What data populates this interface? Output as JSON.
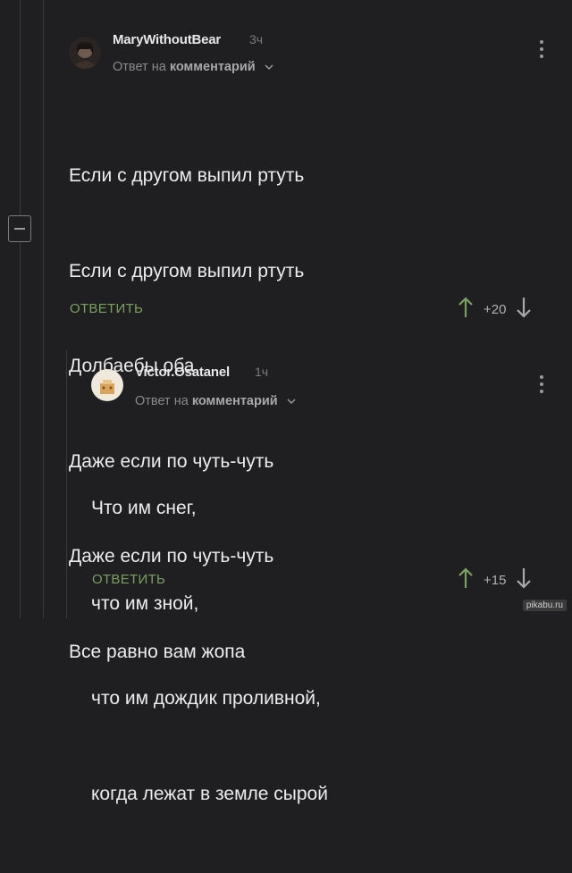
{
  "thread": {
    "collapse_icon": "minus-square-icon"
  },
  "comments": [
    {
      "username": "MaryWithoutBear",
      "time": "3ч",
      "reply_prefix": "Ответ на",
      "reply_target": "комментарий",
      "lines": [
        "Если с другом выпил ртуть",
        "Если с другом выпил ртуть",
        "Долбаебы оба",
        "Даже если по чуть-чуть",
        "Даже если по чуть-чуть",
        "Все равно вам жопа"
      ],
      "reply_label": "ОТВЕТИТЬ",
      "score": "+20"
    },
    {
      "username": "Victor.Osatanel",
      "time": "1ч",
      "reply_prefix": "Ответ на",
      "reply_target": "комментарий",
      "lines": [
        "Что им снег,",
        "что им зной,",
        "что им дождик проливной,",
        "когда лежат в земле сырой"
      ],
      "reply_label": "ОТВЕТИТЬ",
      "score": "+15"
    }
  ],
  "watermark": "pikabu.ru",
  "colors": {
    "background": "#1f1f21",
    "reply_button": "#7aa05f",
    "upvote": "#7aa05f"
  }
}
